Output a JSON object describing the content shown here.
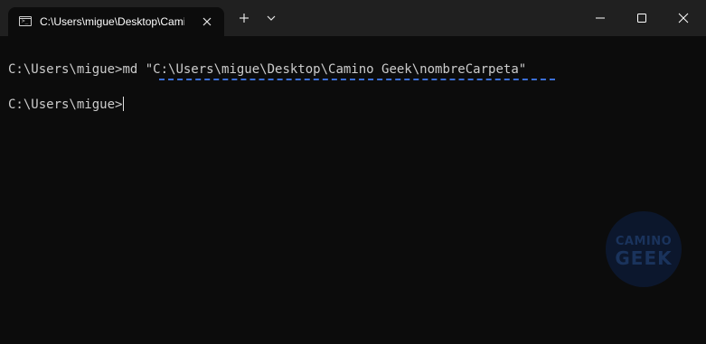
{
  "tab": {
    "title": "C:\\Users\\migue\\Desktop\\Camino Geek\\nombreCarpeta",
    "icon": "terminal-icon"
  },
  "titlebar": {
    "new_tab_icon": "plus-icon",
    "dropdown_icon": "chevron-down-icon",
    "minimize_icon": "minimize-icon",
    "maximize_icon": "maximize-icon",
    "close_icon": "close-icon"
  },
  "console": {
    "line1_prompt": "C:\\Users\\migue>",
    "line1_command": "md ",
    "line1_argument": "\"C:\\Users\\migue\\Desktop\\Camino Geek\\nombreCarpeta\"",
    "line2_prompt": "C:\\Users\\migue>"
  },
  "watermark": {
    "line1": "CAMINO",
    "line2": "GEEK"
  },
  "colors": {
    "background": "#0c0c0c",
    "titlebar": "#202020",
    "text": "#cccccc",
    "squiggle": "#3b6fd6"
  }
}
